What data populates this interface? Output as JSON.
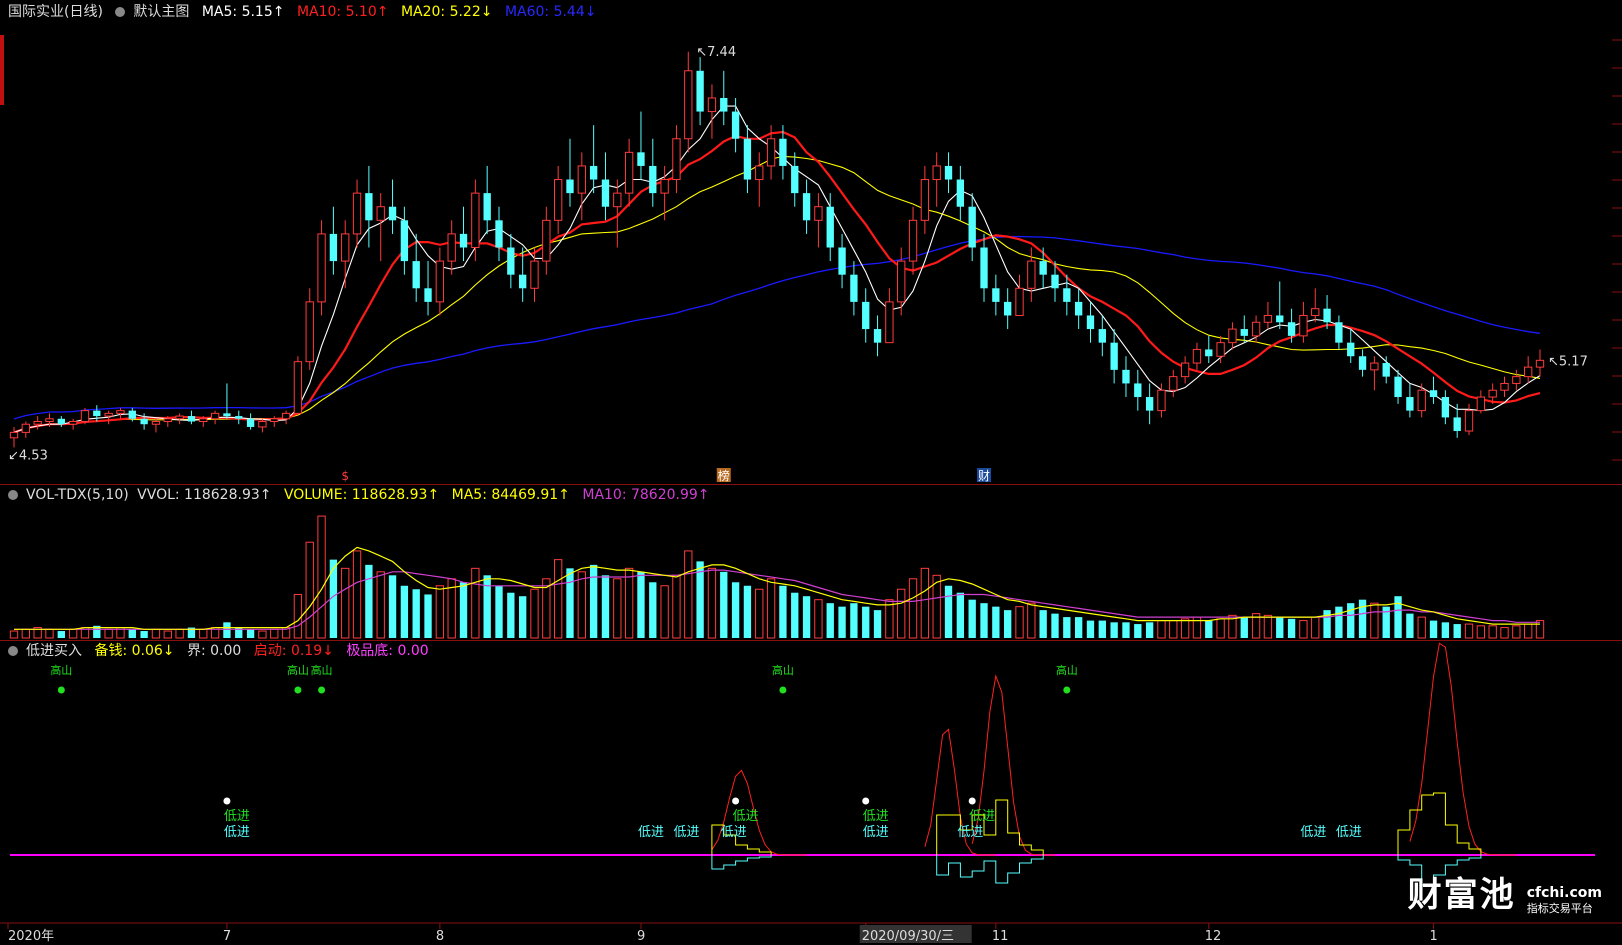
{
  "main_header": {
    "title": "国际实业(日线)",
    "template": "默认主图",
    "ma5": "MA5: 5.15↑",
    "ma10": "MA10: 5.10↑",
    "ma20": "MA20: 5.22↓",
    "ma60": "MA60: 5.44↓"
  },
  "vol_header": {
    "name": "VOL-TDX(5,10)",
    "vvol": "VVOL: 118628.93↑",
    "volume": "VOLUME: 118628.93↑",
    "ma5": "MA5: 84469.91↑",
    "ma10": "MA10: 78620.99↑"
  },
  "ind_header": {
    "name": "低进买入",
    "beiqian": "备钱: 0.06↓",
    "jie": "界: 0.00",
    "qidong": "启动: 0.19↓",
    "jipindi": "极品底: 0.00"
  },
  "annotations": {
    "high": "7.44",
    "low": "4.53",
    "last": "5.17",
    "marker_bang": "榜",
    "marker_cai": "财",
    "marker_dollar": "$",
    "low_entry": "低进",
    "top_marker": "高山"
  },
  "x_axis": {
    "labels": [
      "2020年",
      "7",
      "8",
      "9",
      "2020/09/30/三",
      "11",
      "12",
      "1"
    ]
  },
  "watermark": {
    "brand": "财富池",
    "url": "cfchi.com",
    "sub": "指标交易平台"
  },
  "colors": {
    "up": "#ff3b3b",
    "down": "#54ffff",
    "ma5": "#ffffff",
    "ma10": "#ff1a1a",
    "ma20": "#ffff00",
    "ma60": "#1a1aff",
    "vol_ma10": "#d040d0",
    "vol_ma5": "#ffff00",
    "baseline": "#ff00ff"
  },
  "chart_data": {
    "type": "candlestick",
    "title": "国际实业(日线)",
    "y_range": [
      4.4,
      7.6
    ],
    "x_labels": [
      "2020年",
      "7",
      "8",
      "9",
      "2020/09/30/三",
      "11",
      "12",
      "1"
    ],
    "ohlc": [
      [
        4.6,
        4.68,
        4.53,
        4.64
      ],
      [
        4.64,
        4.72,
        4.6,
        4.7
      ],
      [
        4.7,
        4.76,
        4.66,
        4.72
      ],
      [
        4.72,
        4.78,
        4.68,
        4.74
      ],
      [
        4.74,
        4.76,
        4.68,
        4.7
      ],
      [
        4.7,
        4.74,
        4.66,
        4.72
      ],
      [
        4.72,
        4.82,
        4.7,
        4.8
      ],
      [
        4.8,
        4.84,
        4.72,
        4.76
      ],
      [
        4.76,
        4.8,
        4.7,
        4.78
      ],
      [
        4.78,
        4.82,
        4.74,
        4.8
      ],
      [
        4.8,
        4.82,
        4.72,
        4.74
      ],
      [
        4.74,
        4.78,
        4.66,
        4.7
      ],
      [
        4.7,
        4.74,
        4.64,
        4.72
      ],
      [
        4.72,
        4.76,
        4.68,
        4.74
      ],
      [
        4.74,
        4.78,
        4.7,
        4.76
      ],
      [
        4.76,
        4.8,
        4.7,
        4.72
      ],
      [
        4.72,
        4.76,
        4.68,
        4.74
      ],
      [
        4.74,
        4.8,
        4.7,
        4.78
      ],
      [
        4.78,
        5.0,
        4.74,
        4.76
      ],
      [
        4.76,
        4.8,
        4.7,
        4.74
      ],
      [
        4.74,
        4.78,
        4.66,
        4.68
      ],
      [
        4.68,
        4.74,
        4.64,
        4.72
      ],
      [
        4.72,
        4.76,
        4.68,
        4.74
      ],
      [
        4.74,
        4.8,
        4.7,
        4.78
      ],
      [
        4.78,
        5.2,
        4.76,
        5.16
      ],
      [
        5.16,
        5.7,
        5.1,
        5.6
      ],
      [
        5.6,
        6.2,
        5.5,
        6.1
      ],
      [
        6.1,
        6.3,
        5.8,
        5.9
      ],
      [
        5.9,
        6.2,
        5.7,
        6.1
      ],
      [
        6.1,
        6.5,
        6.0,
        6.4
      ],
      [
        6.4,
        6.6,
        6.0,
        6.2
      ],
      [
        6.2,
        6.4,
        5.9,
        6.3
      ],
      [
        6.3,
        6.5,
        6.1,
        6.2
      ],
      [
        6.2,
        6.3,
        5.8,
        5.9
      ],
      [
        5.9,
        6.1,
        5.6,
        5.7
      ],
      [
        5.7,
        5.9,
        5.5,
        5.6
      ],
      [
        5.6,
        6.0,
        5.5,
        5.9
      ],
      [
        5.9,
        6.2,
        5.8,
        6.1
      ],
      [
        6.1,
        6.3,
        5.9,
        6.0
      ],
      [
        6.0,
        6.5,
        5.9,
        6.4
      ],
      [
        6.4,
        6.6,
        6.1,
        6.2
      ],
      [
        6.2,
        6.3,
        5.9,
        6.0
      ],
      [
        6.0,
        6.1,
        5.7,
        5.8
      ],
      [
        5.8,
        6.0,
        5.6,
        5.7
      ],
      [
        5.7,
        6.0,
        5.6,
        5.9
      ],
      [
        5.9,
        6.3,
        5.8,
        6.2
      ],
      [
        6.2,
        6.6,
        6.1,
        6.5
      ],
      [
        6.5,
        6.8,
        6.3,
        6.4
      ],
      [
        6.4,
        6.7,
        6.2,
        6.6
      ],
      [
        6.6,
        6.9,
        6.4,
        6.5
      ],
      [
        6.5,
        6.7,
        6.2,
        6.3
      ],
      [
        6.3,
        6.5,
        6.0,
        6.4
      ],
      [
        6.4,
        6.8,
        6.3,
        6.7
      ],
      [
        6.7,
        7.0,
        6.5,
        6.6
      ],
      [
        6.6,
        6.8,
        6.3,
        6.4
      ],
      [
        6.4,
        6.6,
        6.2,
        6.5
      ],
      [
        6.5,
        6.9,
        6.4,
        6.8
      ],
      [
        6.8,
        7.44,
        6.7,
        7.3
      ],
      [
        7.3,
        7.4,
        6.9,
        7.0
      ],
      [
        7.0,
        7.2,
        6.8,
        7.1
      ],
      [
        7.1,
        7.3,
        6.9,
        7.0
      ],
      [
        7.0,
        7.1,
        6.7,
        6.8
      ],
      [
        6.8,
        6.9,
        6.4,
        6.5
      ],
      [
        6.5,
        6.7,
        6.3,
        6.6
      ],
      [
        6.6,
        6.9,
        6.5,
        6.8
      ],
      [
        6.8,
        6.9,
        6.5,
        6.6
      ],
      [
        6.6,
        6.7,
        6.3,
        6.4
      ],
      [
        6.4,
        6.5,
        6.1,
        6.2
      ],
      [
        6.2,
        6.4,
        6.0,
        6.3
      ],
      [
        6.3,
        6.4,
        5.9,
        6.0
      ],
      [
        6.0,
        6.1,
        5.7,
        5.8
      ],
      [
        5.8,
        5.9,
        5.5,
        5.6
      ],
      [
        5.6,
        5.7,
        5.3,
        5.4
      ],
      [
        5.4,
        5.5,
        5.2,
        5.3
      ],
      [
        5.3,
        5.7,
        5.3,
        5.6
      ],
      [
        5.6,
        6.0,
        5.5,
        5.9
      ],
      [
        5.9,
        6.3,
        5.8,
        6.2
      ],
      [
        6.2,
        6.6,
        6.1,
        6.5
      ],
      [
        6.5,
        6.7,
        6.3,
        6.6
      ],
      [
        6.6,
        6.7,
        6.4,
        6.5
      ],
      [
        6.5,
        6.6,
        6.2,
        6.3
      ],
      [
        6.3,
        6.4,
        5.9,
        6.0
      ],
      [
        6.0,
        6.1,
        5.6,
        5.7
      ],
      [
        5.7,
        5.8,
        5.5,
        5.6
      ],
      [
        5.6,
        5.7,
        5.4,
        5.5
      ],
      [
        5.5,
        5.8,
        5.5,
        5.7
      ],
      [
        5.7,
        6.0,
        5.6,
        5.9
      ],
      [
        5.9,
        6.0,
        5.7,
        5.8
      ],
      [
        5.8,
        5.9,
        5.6,
        5.7
      ],
      [
        5.7,
        5.8,
        5.5,
        5.6
      ],
      [
        5.6,
        5.7,
        5.4,
        5.5
      ],
      [
        5.5,
        5.6,
        5.3,
        5.4
      ],
      [
        5.4,
        5.5,
        5.2,
        5.3
      ],
      [
        5.3,
        5.4,
        5.0,
        5.1
      ],
      [
        5.1,
        5.2,
        4.9,
        5.0
      ],
      [
        5.0,
        5.1,
        4.8,
        4.9
      ],
      [
        4.9,
        5.0,
        4.7,
        4.8
      ],
      [
        4.8,
        5.0,
        4.75,
        4.95
      ],
      [
        4.95,
        5.1,
        4.9,
        5.05
      ],
      [
        5.05,
        5.2,
        5.0,
        5.15
      ],
      [
        5.15,
        5.3,
        5.1,
        5.25
      ],
      [
        5.25,
        5.35,
        5.15,
        5.2
      ],
      [
        5.2,
        5.35,
        5.15,
        5.3
      ],
      [
        5.3,
        5.45,
        5.25,
        5.4
      ],
      [
        5.4,
        5.5,
        5.3,
        5.35
      ],
      [
        5.35,
        5.5,
        5.3,
        5.45
      ],
      [
        5.45,
        5.6,
        5.4,
        5.5
      ],
      [
        5.5,
        5.75,
        5.4,
        5.45
      ],
      [
        5.45,
        5.55,
        5.3,
        5.35
      ],
      [
        5.35,
        5.6,
        5.3,
        5.5
      ],
      [
        5.5,
        5.7,
        5.45,
        5.55
      ],
      [
        5.55,
        5.65,
        5.4,
        5.45
      ],
      [
        5.45,
        5.5,
        5.25,
        5.3
      ],
      [
        5.3,
        5.4,
        5.15,
        5.2
      ],
      [
        5.2,
        5.25,
        5.05,
        5.1
      ],
      [
        5.1,
        5.2,
        4.95,
        5.15
      ],
      [
        5.15,
        5.2,
        5.0,
        5.05
      ],
      [
        5.05,
        5.1,
        4.85,
        4.9
      ],
      [
        4.9,
        5.0,
        4.75,
        4.8
      ],
      [
        4.8,
        5.0,
        4.75,
        4.95
      ],
      [
        4.95,
        5.05,
        4.85,
        4.9
      ],
      [
        4.9,
        4.95,
        4.7,
        4.75
      ],
      [
        4.75,
        4.85,
        4.6,
        4.65
      ],
      [
        4.65,
        4.85,
        4.62,
        4.8
      ],
      [
        4.8,
        4.95,
        4.78,
        4.9
      ],
      [
        4.9,
        5.0,
        4.85,
        4.95
      ],
      [
        4.95,
        5.05,
        4.9,
        5.0
      ],
      [
        5.0,
        5.1,
        4.95,
        5.05
      ],
      [
        5.05,
        5.2,
        5.0,
        5.12
      ],
      [
        5.12,
        5.25,
        5.05,
        5.17
      ]
    ],
    "volume": [
      4,
      5,
      6,
      5,
      4,
      5,
      6,
      7,
      5,
      6,
      5,
      4,
      5,
      4,
      5,
      6,
      5,
      6,
      9,
      6,
      5,
      4,
      5,
      6,
      25,
      55,
      70,
      45,
      40,
      50,
      42,
      38,
      36,
      30,
      28,
      25,
      30,
      34,
      32,
      40,
      36,
      30,
      26,
      24,
      28,
      34,
      45,
      40,
      38,
      42,
      36,
      34,
      40,
      38,
      32,
      30,
      36,
      50,
      44,
      40,
      38,
      32,
      30,
      28,
      34,
      30,
      26,
      24,
      22,
      20,
      18,
      20,
      18,
      16,
      22,
      28,
      34,
      40,
      36,
      30,
      26,
      22,
      20,
      18,
      16,
      18,
      20,
      16,
      14,
      12,
      12,
      10,
      10,
      9,
      9,
      8,
      9,
      10,
      10,
      11,
      12,
      10,
      11,
      13,
      12,
      14,
      13,
      12,
      11,
      10,
      12,
      16,
      18,
      20,
      22,
      20,
      18,
      24,
      14,
      12,
      10,
      9,
      8,
      8,
      7,
      7,
      6,
      7,
      8,
      10
    ],
    "vol_ma5": [
      5,
      5,
      5,
      5,
      5,
      5,
      6,
      6,
      6,
      6,
      6,
      5,
      5,
      5,
      5,
      5,
      5,
      6,
      6,
      6,
      6,
      6,
      6,
      6,
      10,
      18,
      28,
      40,
      47,
      52,
      50,
      47,
      44,
      38,
      33,
      29,
      28,
      29,
      30,
      32,
      34,
      34,
      33,
      31,
      29,
      29,
      33,
      37,
      40,
      41,
      40,
      39,
      39,
      38,
      37,
      36,
      35,
      38,
      40,
      42,
      42,
      40,
      37,
      34,
      32,
      31,
      30,
      28,
      26,
      24,
      22,
      21,
      20,
      19,
      19,
      20,
      23,
      27,
      32,
      34,
      33,
      31,
      28,
      25,
      22,
      21,
      19,
      18,
      17,
      16,
      15,
      14,
      13,
      12,
      11,
      10,
      10,
      10,
      10,
      10,
      10,
      10,
      11,
      11,
      12,
      12,
      12,
      12,
      12,
      12,
      12,
      13,
      14,
      16,
      18,
      19,
      19,
      20,
      18,
      16,
      15,
      13,
      11,
      10,
      9,
      8,
      8,
      8,
      8,
      8
    ],
    "vol_ma10": [
      5,
      5,
      5,
      5,
      5,
      5,
      5,
      5,
      5,
      5,
      5,
      5,
      5,
      5,
      5,
      5,
      5,
      5,
      5,
      5,
      5,
      5,
      5,
      5,
      7,
      12,
      18,
      24,
      28,
      32,
      34,
      36,
      38,
      38,
      37,
      36,
      35,
      34,
      32,
      31,
      30,
      30,
      30,
      30,
      30,
      30,
      31,
      32,
      34,
      35,
      35,
      35,
      35,
      36,
      36,
      36,
      36,
      37,
      38,
      39,
      39,
      38,
      37,
      36,
      35,
      34,
      33,
      31,
      29,
      27,
      25,
      24,
      23,
      22,
      21,
      21,
      21,
      22,
      23,
      24,
      25,
      25,
      25,
      24,
      23,
      22,
      21,
      20,
      19,
      18,
      17,
      16,
      15,
      14,
      13,
      12,
      12,
      12,
      12,
      12,
      12,
      12,
      12,
      12,
      12,
      12,
      12,
      12,
      12,
      12,
      12,
      12,
      13,
      13,
      14,
      15,
      15,
      16,
      16,
      15,
      15,
      14,
      13,
      12,
      11,
      10,
      10,
      9,
      9,
      9
    ],
    "indicator": {
      "names": [
        "备钱",
        "界",
        "启动",
        "极品底"
      ],
      "qidong_peaks": [
        0.2,
        0.7,
        0.6,
        0.8,
        1.0
      ],
      "signals_low_entry": 14,
      "signals_top": 5
    }
  }
}
